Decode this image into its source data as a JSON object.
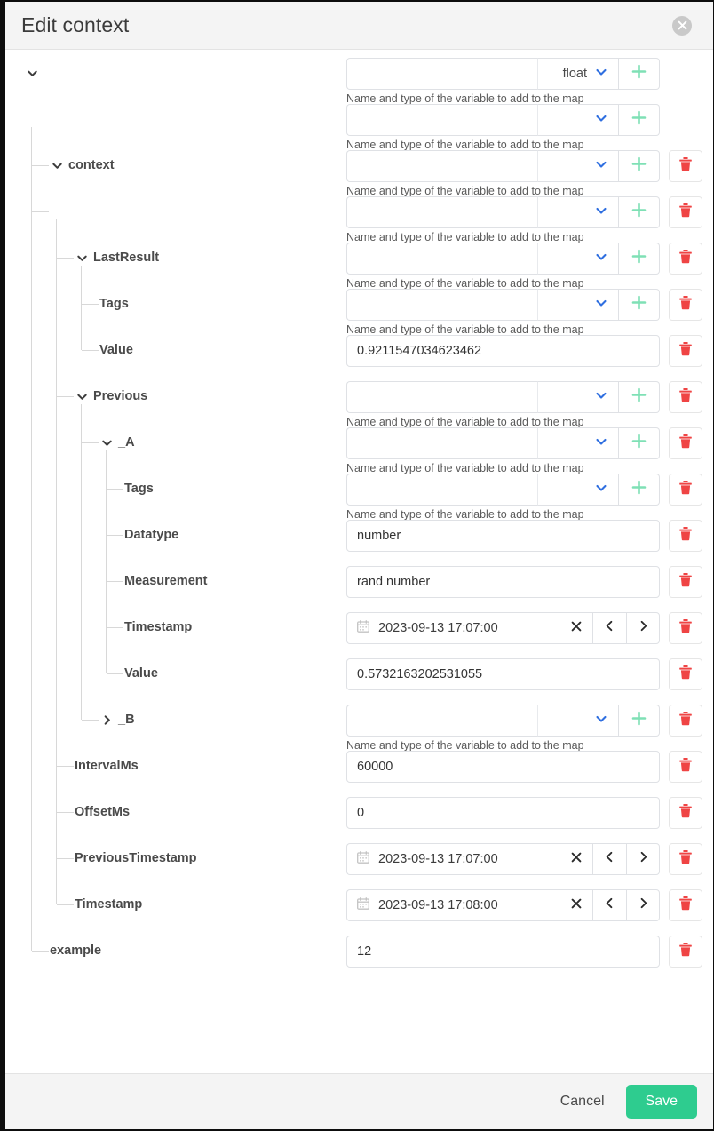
{
  "dialog": {
    "title": "Edit context",
    "close_icon": "close-icon"
  },
  "helper_text": "Name and type of the variable to add to the map",
  "colors": {
    "add_green": "#7fe0b5",
    "delete_red": "#ef4444",
    "chevron_blue": "#2f6fe0",
    "save_green": "#2ecc8f",
    "header_bg": "#f4f4f4",
    "tree_line": "#d8d8d8"
  },
  "select_placeholder": "",
  "name_placeholder": "",
  "footer": {
    "cancel_label": "Cancel",
    "save_label": "Save"
  },
  "rows": [
    {
      "tree": {
        "label": "",
        "depth": 0,
        "chevron": "down",
        "has_chevron": true
      },
      "control": {
        "kind": "name-type",
        "name_value": "",
        "type_value": "float",
        "has_delete": false,
        "helper": true
      }
    },
    {
      "tree": {
        "label": "",
        "depth": 0,
        "chevron": "none",
        "has_chevron": false
      },
      "control": {
        "kind": "name-type",
        "name_value": "",
        "type_value": "",
        "has_delete": false,
        "helper": true
      }
    },
    {
      "tree": {
        "label": "context",
        "depth": 1,
        "chevron": "down",
        "has_chevron": true
      },
      "control": {
        "kind": "name-type",
        "name_value": "",
        "type_value": "",
        "has_delete": true,
        "helper": true
      }
    },
    {
      "tree": {
        "label": "",
        "depth": 1,
        "chevron": "none",
        "has_chevron": false
      },
      "control": {
        "kind": "name-type",
        "name_value": "",
        "type_value": "",
        "has_delete": true,
        "helper": true
      }
    },
    {
      "tree": {
        "label": "LastResult",
        "depth": 2,
        "chevron": "down",
        "has_chevron": true
      },
      "control": {
        "kind": "name-type",
        "name_value": "",
        "type_value": "",
        "has_delete": true,
        "helper": true
      }
    },
    {
      "tree": {
        "label": "Tags",
        "depth": 3,
        "chevron": "none",
        "has_chevron": false
      },
      "control": {
        "kind": "name-type",
        "name_value": "",
        "type_value": "",
        "has_delete": true,
        "helper": true
      }
    },
    {
      "tree": {
        "label": "Value",
        "depth": 3,
        "chevron": "none",
        "has_chevron": false
      },
      "control": {
        "kind": "text",
        "value": "0.9211547034623462",
        "has_delete": true,
        "helper": false
      }
    },
    {
      "tree": {
        "label": "Previous",
        "depth": 2,
        "chevron": "down",
        "has_chevron": true
      },
      "control": {
        "kind": "name-type",
        "name_value": "",
        "type_value": "",
        "has_delete": true,
        "helper": true
      }
    },
    {
      "tree": {
        "label": "_A",
        "depth": 3,
        "chevron": "down",
        "has_chevron": true
      },
      "control": {
        "kind": "name-type",
        "name_value": "",
        "type_value": "",
        "has_delete": true,
        "helper": true
      }
    },
    {
      "tree": {
        "label": "Tags",
        "depth": 4,
        "chevron": "none",
        "has_chevron": false
      },
      "control": {
        "kind": "name-type",
        "name_value": "",
        "type_value": "",
        "has_delete": true,
        "helper": true
      }
    },
    {
      "tree": {
        "label": "Datatype",
        "depth": 4,
        "chevron": "none",
        "has_chevron": false
      },
      "control": {
        "kind": "text",
        "value": "number",
        "has_delete": true,
        "helper": false
      }
    },
    {
      "tree": {
        "label": "Measurement",
        "depth": 4,
        "chevron": "none",
        "has_chevron": false
      },
      "control": {
        "kind": "text",
        "value": "rand number",
        "has_delete": true,
        "helper": false
      }
    },
    {
      "tree": {
        "label": "Timestamp",
        "depth": 4,
        "chevron": "none",
        "has_chevron": false
      },
      "control": {
        "kind": "date",
        "value": "2023-09-13 17:07:00",
        "has_delete": true,
        "helper": false
      }
    },
    {
      "tree": {
        "label": "Value",
        "depth": 4,
        "chevron": "none",
        "has_chevron": false
      },
      "control": {
        "kind": "text",
        "value": "0.5732163202531055",
        "has_delete": true,
        "helper": false
      }
    },
    {
      "tree": {
        "label": "_B",
        "depth": 3,
        "chevron": "right",
        "has_chevron": true
      },
      "control": {
        "kind": "name-type",
        "name_value": "",
        "type_value": "",
        "has_delete": true,
        "helper": true
      }
    },
    {
      "tree": {
        "label": "IntervalMs",
        "depth": 2,
        "chevron": "none",
        "has_chevron": false
      },
      "control": {
        "kind": "text",
        "value": "60000",
        "has_delete": true,
        "helper": false
      }
    },
    {
      "tree": {
        "label": "OffsetMs",
        "depth": 2,
        "chevron": "none",
        "has_chevron": false
      },
      "control": {
        "kind": "text",
        "value": "0",
        "has_delete": true,
        "helper": false
      }
    },
    {
      "tree": {
        "label": "PreviousTimestamp",
        "depth": 2,
        "chevron": "none",
        "has_chevron": false
      },
      "control": {
        "kind": "date",
        "value": "2023-09-13 17:07:00",
        "has_delete": true,
        "helper": false
      }
    },
    {
      "tree": {
        "label": "Timestamp",
        "depth": 2,
        "chevron": "none",
        "has_chevron": false
      },
      "control": {
        "kind": "date",
        "value": "2023-09-13 17:08:00",
        "has_delete": true,
        "helper": false
      }
    },
    {
      "tree": {
        "label": "example",
        "depth": 1,
        "chevron": "none",
        "has_chevron": false
      },
      "control": {
        "kind": "text",
        "value": "12",
        "has_delete": true,
        "helper": false
      }
    }
  ]
}
